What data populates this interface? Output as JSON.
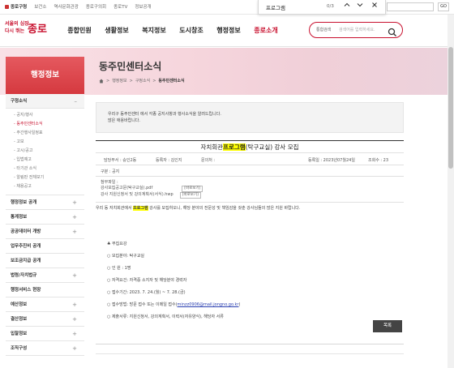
{
  "topbar": {
    "links": [
      "종로구청",
      "보건소",
      "역사문화관광",
      "종로구의회",
      "종로TV",
      "정보공개"
    ],
    "lang_select": "",
    "go_label": "GO"
  },
  "findbar": {
    "term": "프로그램",
    "count": "0/3",
    "up": "^",
    "down": "v",
    "close": "×"
  },
  "header": {
    "logo_line1": "서울의 심장",
    "logo_line2": "다시 뛰는",
    "logo_big": "종로",
    "nav": [
      "종합민원",
      "생활정보",
      "복지정보",
      "도시창조",
      "행정정보",
      "종로소개"
    ],
    "active_nav": "종로소개",
    "search_scope": "통합검색",
    "search_placeholder": "검색어를 입력하세요."
  },
  "banner": {
    "title": "동주민센터소식",
    "breadcrumb": [
      "행정정보",
      "구정소식",
      "동주민센터소식"
    ]
  },
  "lnb": {
    "title": "행정정보",
    "open_section": "구정소식",
    "sub_items": [
      "공지/행사",
      "동주민센터소식",
      "주간행사일정표",
      "고보",
      "고시/공고",
      "입법예고",
      "타기관 소식",
      "알림판 전체보기",
      "채용공고"
    ],
    "active_sub": "동주민센터소식",
    "sections": [
      "행정정보 공개",
      "통계정보",
      "공공데이터 개방",
      "업무추진비 공개",
      "보조금지급 공개",
      "법령/자치법규",
      "행정서비스 현장",
      "예산정보",
      "결산정보",
      "입찰정보",
      "조직구성"
    ]
  },
  "content": {
    "intro_line1": "우리구 동주민센터 에서 각종 공지사항과 행사소식을 알려드립니다.",
    "intro_line2": "많은 애용바랍니다.",
    "post_title_pre": "자치회관",
    "post_title_hl": "프로그램",
    "post_title_post": "(탁구교실) 강사 모집",
    "author_label": "담당부서 : 숭인2동",
    "writer_label": "등록자 : 김인지",
    "contact_label": "문의처 :",
    "date_label": "등록일 : 2023년07월24일",
    "views_label": "조회수 : 23",
    "category": "구분 : 공지",
    "files_label": "첨부파일 :",
    "file1": "강사모집공고문(탁구교실).pdf",
    "file2": "강사 지원신청서 및 강의계획서(서식).hwp",
    "view_btn": "[바로보기]",
    "lead_pre": "우리 동 자치회관에서 ",
    "lead_hl": "프로그램",
    "lead_post": " 강사를 모집하오니, 해당 분야의 전문성 및 책임감을 갖춘 강사님들의 많은 지원 바랍니다.",
    "section_head": "♣ 무집요강",
    "items": [
      "○ 모집분야: 탁구교실",
      "○ 인     원 : 1명",
      "○ 자격요건: 자격증 소지자 및 해당분야 경력자",
      "○ 접수기간: 2023. 7. 24.(월) ~ 7. 28.(금)"
    ],
    "email_pre": "○ 접수방법: 방문 접수 또는 이메일 접수(",
    "email": "minzz0906@mail.jongno.go.kr",
    "email_post": ")",
    "last_item": "○ 제출서류: 지원신청서, 강의계획서, 이력서(자유양식), 해당자 서류",
    "list_btn": "목록"
  }
}
